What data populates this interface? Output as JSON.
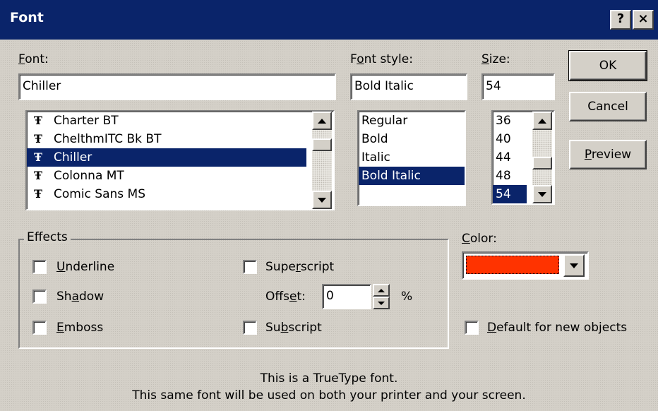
{
  "window": {
    "title": "Font",
    "help_button": "?",
    "close_button": "×"
  },
  "font": {
    "label_pre": "",
    "label_key": "F",
    "label_post": "ont:",
    "value": "Chiller",
    "items": [
      {
        "label": "Charter BT",
        "selected": false
      },
      {
        "label": "ChelthmITC Bk BT",
        "selected": false
      },
      {
        "label": "Chiller",
        "selected": true
      },
      {
        "label": "Colonna MT",
        "selected": false
      },
      {
        "label": "Comic Sans MS",
        "selected": false
      }
    ],
    "type_glyph": "Ŧ"
  },
  "style": {
    "label_pre": "F",
    "label_key": "o",
    "label_post": "nt style:",
    "value": "Bold Italic",
    "items": [
      {
        "label": "Regular",
        "selected": false
      },
      {
        "label": "Bold",
        "selected": false
      },
      {
        "label": "Italic",
        "selected": false
      },
      {
        "label": "Bold Italic",
        "selected": true
      }
    ]
  },
  "size": {
    "label_pre": "",
    "label_key": "S",
    "label_post": "ize:",
    "value": "54",
    "items": [
      {
        "label": "36",
        "selected": false
      },
      {
        "label": "40",
        "selected": false
      },
      {
        "label": "44",
        "selected": false
      },
      {
        "label": "48",
        "selected": false
      },
      {
        "label": "54",
        "selected": true
      }
    ]
  },
  "buttons": {
    "ok": "OK",
    "cancel": "Cancel",
    "preview_key": "P",
    "preview_post": "review"
  },
  "effects": {
    "legend": "Effects",
    "underline_key": "U",
    "underline_post": "nderline",
    "shadow_pre": "Sh",
    "shadow_key": "a",
    "shadow_post": "dow",
    "emboss_key": "E",
    "emboss_post": "mboss",
    "superscript_pre": "Supe",
    "superscript_key": "r",
    "superscript_post": "script",
    "subscript_pre": "Su",
    "subscript_key": "b",
    "subscript_post": "script",
    "offset_pre": "Offs",
    "offset_key": "e",
    "offset_post": "t:",
    "offset_value": "0",
    "offset_unit": "%"
  },
  "color": {
    "label_key": "C",
    "label_post": "olor:",
    "swatch": "#ff3300"
  },
  "default": {
    "key": "D",
    "post": "efault for new objects"
  },
  "info": {
    "line1": "This is a TrueType font.",
    "line2": "This same font will be used on both your printer and your screen."
  }
}
